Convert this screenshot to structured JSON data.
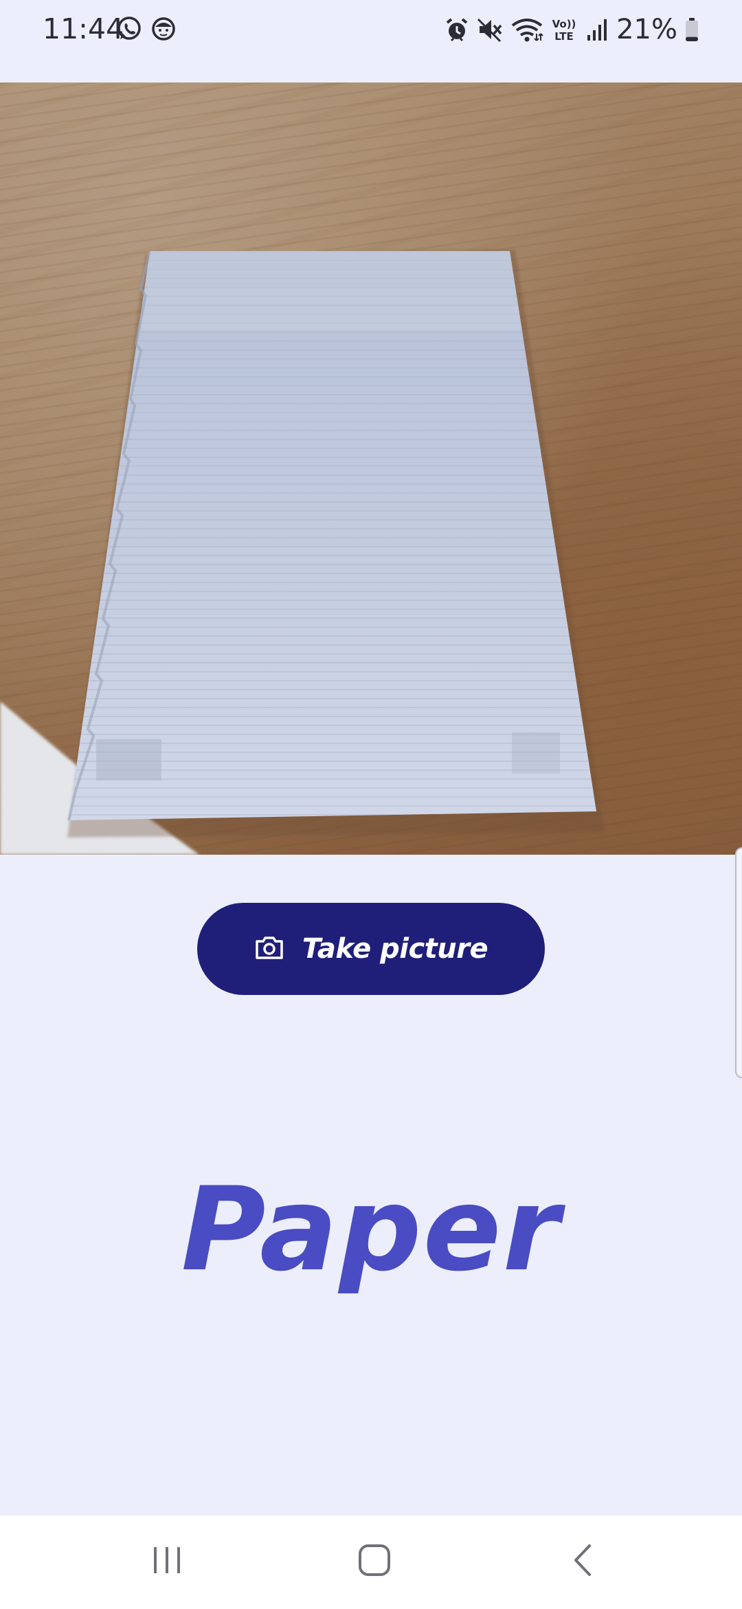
{
  "status_bar": {
    "time": "11:44",
    "left_icons": [
      "whatsapp-icon",
      "face-notification-icon"
    ],
    "right_icons": [
      "alarm-icon",
      "mute-icon",
      "wifi-icon",
      "volte-icon",
      "signal-icon",
      "battery-icon"
    ],
    "volte_text": "VoLTE",
    "battery_percent": "21%",
    "battery_level": 0.21
  },
  "camera": {
    "preview_subject": "paper-sheet-on-wood-table"
  },
  "action": {
    "take_picture_label": "Take picture",
    "icon": "camera-icon"
  },
  "result": {
    "label": "Paper"
  },
  "nav": {
    "recents_icon": "recents-icon",
    "home_icon": "home-icon",
    "back_icon": "back-icon"
  },
  "colors": {
    "background": "#eceefc",
    "button": "#1f1f7a",
    "result_text": "#4a4cc3"
  }
}
